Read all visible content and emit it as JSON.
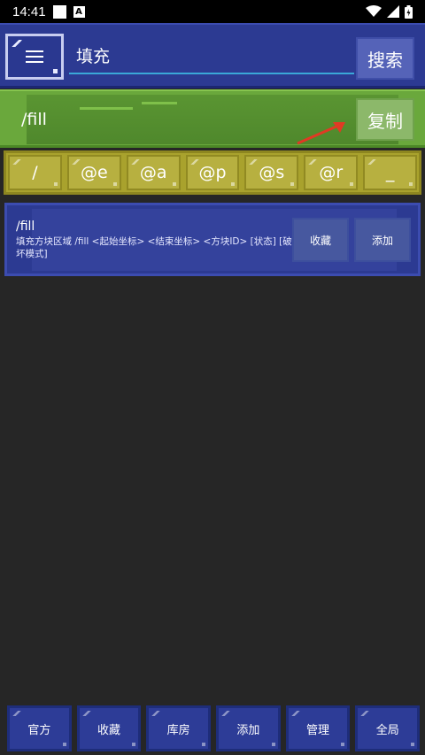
{
  "status_bar": {
    "time": "14:41",
    "icons": [
      "square-icon",
      "a-badge-icon",
      "wifi-icon",
      "signal-icon",
      "battery-icon"
    ]
  },
  "search": {
    "value": "填充",
    "button_label": "搜索",
    "menu_icon": "hamburger-menu-icon"
  },
  "command": {
    "text": "/fill",
    "copy_label": "复制",
    "arrow_color": "#e03a24"
  },
  "symbols": [
    "/",
    "@e",
    "@a",
    "@p",
    "@s",
    "@r",
    "_"
  ],
  "result": {
    "title": "/fill",
    "description": "填充方块区域 /fill <起始坐标> <结束坐标> <方块ID> [状态] [破坏模式]",
    "favorite_label": "收藏",
    "add_label": "添加"
  },
  "bottom_nav": [
    "官方",
    "收藏",
    "库房",
    "添加",
    "管理",
    "全局"
  ],
  "colors": {
    "background": "#262626",
    "topbar": "#2c3a92",
    "command_bar": "#6aa83c",
    "symbol_bar": "#a9a22d",
    "input_underline": "#3aa8d8"
  }
}
